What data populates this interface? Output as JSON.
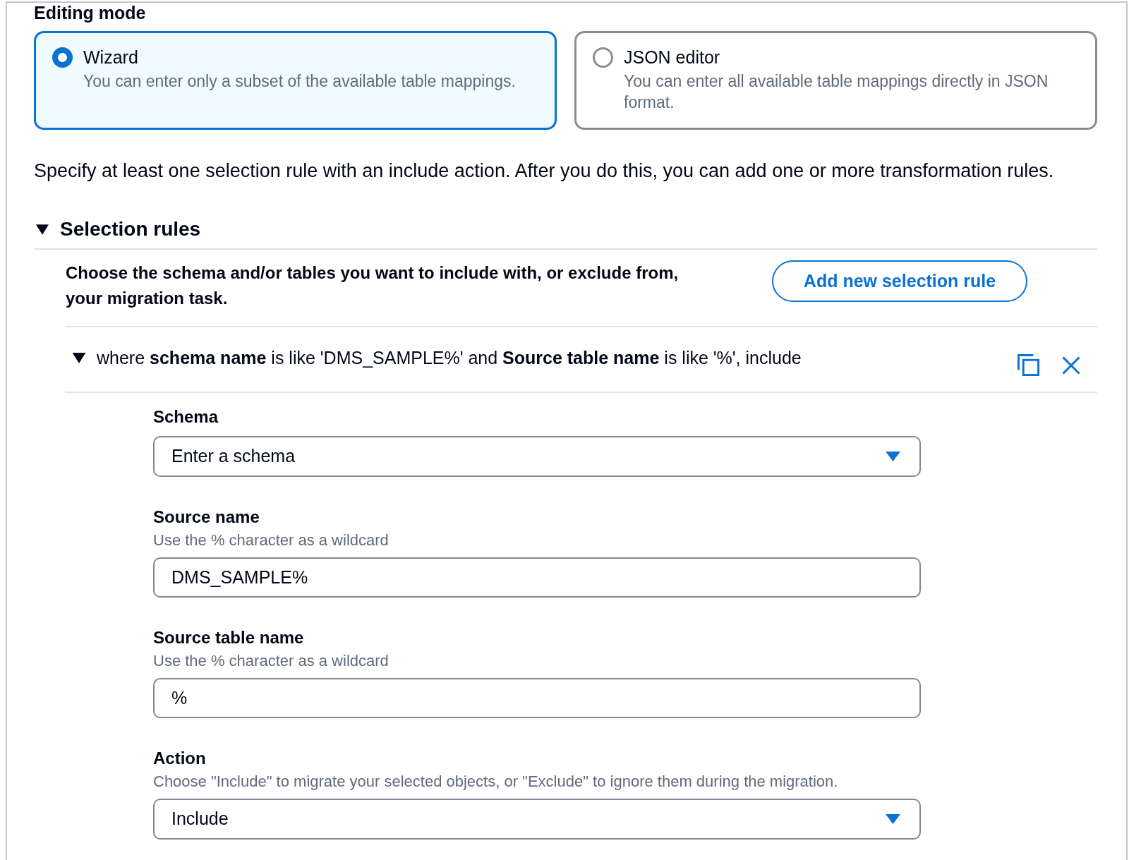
{
  "editing_mode": {
    "title": "Editing mode",
    "options": [
      {
        "label": "Wizard",
        "description": "You can enter only a subset of the available table mappings.",
        "selected": true
      },
      {
        "label": "JSON editor",
        "description": "You can enter all available table mappings directly in JSON format.",
        "selected": false
      }
    ]
  },
  "instructions": "Specify at least one selection rule with an include action. After you do this, you can add one or more transformation rules.",
  "selection_rules": {
    "title": "Selection rules",
    "expanded": true,
    "description": "Choose the schema and/or tables you want to include with, or exclude from, your migration task.",
    "add_button": "Add new selection rule",
    "rules": [
      {
        "summary": "where **schema name** is like 'DMS_SAMPLE%' and **Source table name** is like '%', include",
        "expanded": true,
        "fields": [
          {
            "kind": "select",
            "label": "Schema",
            "placeholder": "Enter a schema"
          },
          {
            "kind": "text",
            "label": "Source name",
            "hint": "Use the % character as a wildcard",
            "value": "DMS_SAMPLE%"
          },
          {
            "kind": "text",
            "label": "Source table name",
            "hint": "Use the % character as a wildcard",
            "value": "%"
          },
          {
            "kind": "select",
            "label": "Action",
            "hint": "Choose \"Include\" to migrate your selected objects, or \"Exclude\" to ignore them during the migration.",
            "value": "Include"
          }
        ]
      }
    ]
  }
}
